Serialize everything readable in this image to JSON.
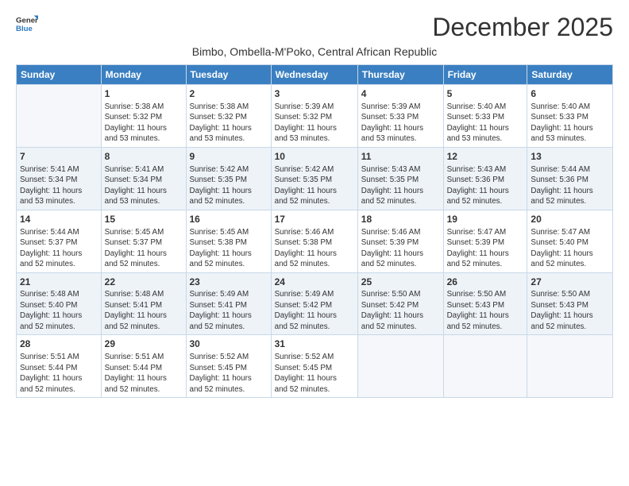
{
  "logo": {
    "general": "General",
    "blue": "Blue"
  },
  "title": "December 2025",
  "subtitle": "Bimbo, Ombella-M'Poko, Central African Republic",
  "days_of_week": [
    "Sunday",
    "Monday",
    "Tuesday",
    "Wednesday",
    "Thursday",
    "Friday",
    "Saturday"
  ],
  "weeks": [
    [
      {
        "day": "",
        "sunrise": "",
        "sunset": "",
        "daylight": ""
      },
      {
        "day": "1",
        "sunrise": "Sunrise: 5:38 AM",
        "sunset": "Sunset: 5:32 PM",
        "daylight": "Daylight: 11 hours and 53 minutes."
      },
      {
        "day": "2",
        "sunrise": "Sunrise: 5:38 AM",
        "sunset": "Sunset: 5:32 PM",
        "daylight": "Daylight: 11 hours and 53 minutes."
      },
      {
        "day": "3",
        "sunrise": "Sunrise: 5:39 AM",
        "sunset": "Sunset: 5:32 PM",
        "daylight": "Daylight: 11 hours and 53 minutes."
      },
      {
        "day": "4",
        "sunrise": "Sunrise: 5:39 AM",
        "sunset": "Sunset: 5:33 PM",
        "daylight": "Daylight: 11 hours and 53 minutes."
      },
      {
        "day": "5",
        "sunrise": "Sunrise: 5:40 AM",
        "sunset": "Sunset: 5:33 PM",
        "daylight": "Daylight: 11 hours and 53 minutes."
      },
      {
        "day": "6",
        "sunrise": "Sunrise: 5:40 AM",
        "sunset": "Sunset: 5:33 PM",
        "daylight": "Daylight: 11 hours and 53 minutes."
      }
    ],
    [
      {
        "day": "7",
        "sunrise": "Sunrise: 5:41 AM",
        "sunset": "Sunset: 5:34 PM",
        "daylight": "Daylight: 11 hours and 53 minutes."
      },
      {
        "day": "8",
        "sunrise": "Sunrise: 5:41 AM",
        "sunset": "Sunset: 5:34 PM",
        "daylight": "Daylight: 11 hours and 53 minutes."
      },
      {
        "day": "9",
        "sunrise": "Sunrise: 5:42 AM",
        "sunset": "Sunset: 5:35 PM",
        "daylight": "Daylight: 11 hours and 52 minutes."
      },
      {
        "day": "10",
        "sunrise": "Sunrise: 5:42 AM",
        "sunset": "Sunset: 5:35 PM",
        "daylight": "Daylight: 11 hours and 52 minutes."
      },
      {
        "day": "11",
        "sunrise": "Sunrise: 5:43 AM",
        "sunset": "Sunset: 5:35 PM",
        "daylight": "Daylight: 11 hours and 52 minutes."
      },
      {
        "day": "12",
        "sunrise": "Sunrise: 5:43 AM",
        "sunset": "Sunset: 5:36 PM",
        "daylight": "Daylight: 11 hours and 52 minutes."
      },
      {
        "day": "13",
        "sunrise": "Sunrise: 5:44 AM",
        "sunset": "Sunset: 5:36 PM",
        "daylight": "Daylight: 11 hours and 52 minutes."
      }
    ],
    [
      {
        "day": "14",
        "sunrise": "Sunrise: 5:44 AM",
        "sunset": "Sunset: 5:37 PM",
        "daylight": "Daylight: 11 hours and 52 minutes."
      },
      {
        "day": "15",
        "sunrise": "Sunrise: 5:45 AM",
        "sunset": "Sunset: 5:37 PM",
        "daylight": "Daylight: 11 hours and 52 minutes."
      },
      {
        "day": "16",
        "sunrise": "Sunrise: 5:45 AM",
        "sunset": "Sunset: 5:38 PM",
        "daylight": "Daylight: 11 hours and 52 minutes."
      },
      {
        "day": "17",
        "sunrise": "Sunrise: 5:46 AM",
        "sunset": "Sunset: 5:38 PM",
        "daylight": "Daylight: 11 hours and 52 minutes."
      },
      {
        "day": "18",
        "sunrise": "Sunrise: 5:46 AM",
        "sunset": "Sunset: 5:39 PM",
        "daylight": "Daylight: 11 hours and 52 minutes."
      },
      {
        "day": "19",
        "sunrise": "Sunrise: 5:47 AM",
        "sunset": "Sunset: 5:39 PM",
        "daylight": "Daylight: 11 hours and 52 minutes."
      },
      {
        "day": "20",
        "sunrise": "Sunrise: 5:47 AM",
        "sunset": "Sunset: 5:40 PM",
        "daylight": "Daylight: 11 hours and 52 minutes."
      }
    ],
    [
      {
        "day": "21",
        "sunrise": "Sunrise: 5:48 AM",
        "sunset": "Sunset: 5:40 PM",
        "daylight": "Daylight: 11 hours and 52 minutes."
      },
      {
        "day": "22",
        "sunrise": "Sunrise: 5:48 AM",
        "sunset": "Sunset: 5:41 PM",
        "daylight": "Daylight: 11 hours and 52 minutes."
      },
      {
        "day": "23",
        "sunrise": "Sunrise: 5:49 AM",
        "sunset": "Sunset: 5:41 PM",
        "daylight": "Daylight: 11 hours and 52 minutes."
      },
      {
        "day": "24",
        "sunrise": "Sunrise: 5:49 AM",
        "sunset": "Sunset: 5:42 PM",
        "daylight": "Daylight: 11 hours and 52 minutes."
      },
      {
        "day": "25",
        "sunrise": "Sunrise: 5:50 AM",
        "sunset": "Sunset: 5:42 PM",
        "daylight": "Daylight: 11 hours and 52 minutes."
      },
      {
        "day": "26",
        "sunrise": "Sunrise: 5:50 AM",
        "sunset": "Sunset: 5:43 PM",
        "daylight": "Daylight: 11 hours and 52 minutes."
      },
      {
        "day": "27",
        "sunrise": "Sunrise: 5:50 AM",
        "sunset": "Sunset: 5:43 PM",
        "daylight": "Daylight: 11 hours and 52 minutes."
      }
    ],
    [
      {
        "day": "28",
        "sunrise": "Sunrise: 5:51 AM",
        "sunset": "Sunset: 5:44 PM",
        "daylight": "Daylight: 11 hours and 52 minutes."
      },
      {
        "day": "29",
        "sunrise": "Sunrise: 5:51 AM",
        "sunset": "Sunset: 5:44 PM",
        "daylight": "Daylight: 11 hours and 52 minutes."
      },
      {
        "day": "30",
        "sunrise": "Sunrise: 5:52 AM",
        "sunset": "Sunset: 5:45 PM",
        "daylight": "Daylight: 11 hours and 52 minutes."
      },
      {
        "day": "31",
        "sunrise": "Sunrise: 5:52 AM",
        "sunset": "Sunset: 5:45 PM",
        "daylight": "Daylight: 11 hours and 52 minutes."
      },
      {
        "day": "",
        "sunrise": "",
        "sunset": "",
        "daylight": ""
      },
      {
        "day": "",
        "sunrise": "",
        "sunset": "",
        "daylight": ""
      },
      {
        "day": "",
        "sunrise": "",
        "sunset": "",
        "daylight": ""
      }
    ]
  ]
}
